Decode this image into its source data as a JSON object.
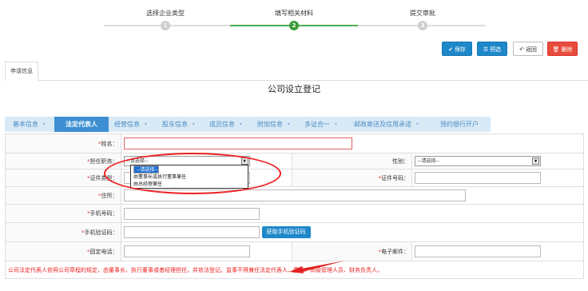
{
  "steps": [
    {
      "label": "选择企业类型",
      "number": "1"
    },
    {
      "label": "填写相关材料",
      "number": "2"
    },
    {
      "label": "提交审批",
      "number": "3"
    }
  ],
  "actions": {
    "save": "保存",
    "preview": "预选",
    "back": "返回",
    "delete": "删除"
  },
  "tab": "申请信息",
  "form_title": "公司设立登记",
  "categories": [
    "基本信息",
    "法定代表人",
    "经营信息",
    "股东信息",
    "成员信息",
    "附加信息",
    "多证合一",
    "邮政寄送及信用承诺",
    "预约银行开户"
  ],
  "form": {
    "name_label": "姓名：",
    "position_label": "担任职务：",
    "gender_label": "性别：",
    "id_type_label": "证件类型：",
    "id_number_label": "证件号码：",
    "address_label": "住所：",
    "phone_label": "手机号码：",
    "sms_label": "手机验证码：",
    "sms_button": "获取手机验证码",
    "tel_label": "固定电话：",
    "email_label": "电子邮件：",
    "required_mark": "*",
    "select_placeholder": "--请选择--",
    "position_options": [
      "--请选择--",
      "由董事长或执行董事兼任",
      "由总经理兼任"
    ],
    "note": "公司法定代表人依照公司章程的规定，由董事长、执行董事或者经理担任，并依法登记。监事不得兼任法定代表人、董事、高级管理人员、财务负责人。"
  },
  "colors": {
    "accent": "#1e88c9",
    "danger": "#e74c3c",
    "step_active": "#3a9d3a",
    "annotation": "#e22222"
  }
}
